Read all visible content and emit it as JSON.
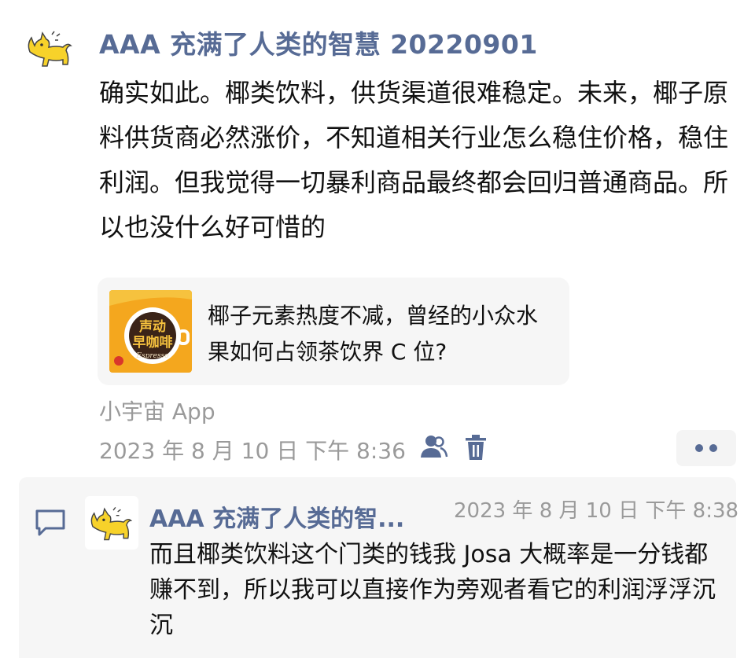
{
  "post": {
    "author": "AAA 充满了人类的智慧 20220901",
    "text": "确实如此。椰类饮料，供货渠道很难稳定。未来，椰子原料供货商必然涨价，不知道相关行业怎么稳住价格，稳住利润。但我觉得一切暴利商品最终都会回归普通商品。所以也没什么好可惜的",
    "link_card": {
      "title": "椰子元素热度不减，曾经的小众水果如何占领茶饮界 C 位?",
      "thumb_text_line1": "声动",
      "thumb_text_line2": "早咖啡",
      "thumb_script": "Espresso"
    },
    "source": "小宇宙 App",
    "time": "2023 年 8 月 10 日 下午 8:36"
  },
  "comment": {
    "author": "AAA 充满了人类的智...",
    "time": "2023 年 8 月 10 日 下午 8:38",
    "text": "而且椰类饮料这个门类的钱我 Josa 大概率是一分钱都赚不到，所以我可以直接作为旁观者看它的利润浮浮沉沉"
  },
  "icons": {
    "avatar": "yellow-cat-icon",
    "visibility": "people-icon",
    "delete": "trash-icon",
    "more": "more-dots-icon",
    "comment": "comment-bubble-icon"
  },
  "colors": {
    "name_link": "#576b95",
    "secondary_text": "#9a9a9a",
    "card_bg": "#f6f6f6",
    "avatar_cat": "#f7d22a"
  }
}
